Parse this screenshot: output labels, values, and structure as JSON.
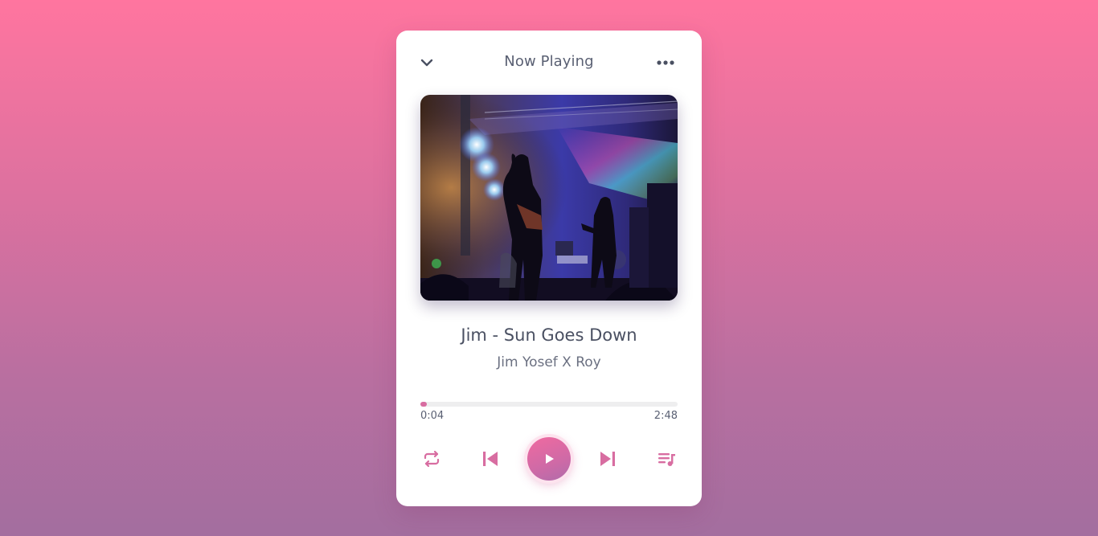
{
  "header": {
    "title": "Now Playing",
    "back_icon": "chevron-down-icon",
    "menu_icon": "more-horizontal-icon"
  },
  "track": {
    "title": "Jim - Sun Goes Down",
    "artist": "Jim Yosef X Roy",
    "cover": "concert-stage-photo"
  },
  "progress": {
    "current": "0:04",
    "total": "2:48",
    "fraction": 0.024
  },
  "controls": {
    "repeat_icon": "repeat-icon",
    "prev_icon": "skip-previous-icon",
    "play_icon": "play-icon",
    "next_icon": "skip-next-icon",
    "queue_icon": "playlist-icon"
  },
  "colors": {
    "accent": "#d86da1",
    "text": "#4a5062",
    "muted": "#6b7081",
    "background_top": "#ff759f",
    "background_bottom": "#a36e9f",
    "card": "#ffffff"
  }
}
